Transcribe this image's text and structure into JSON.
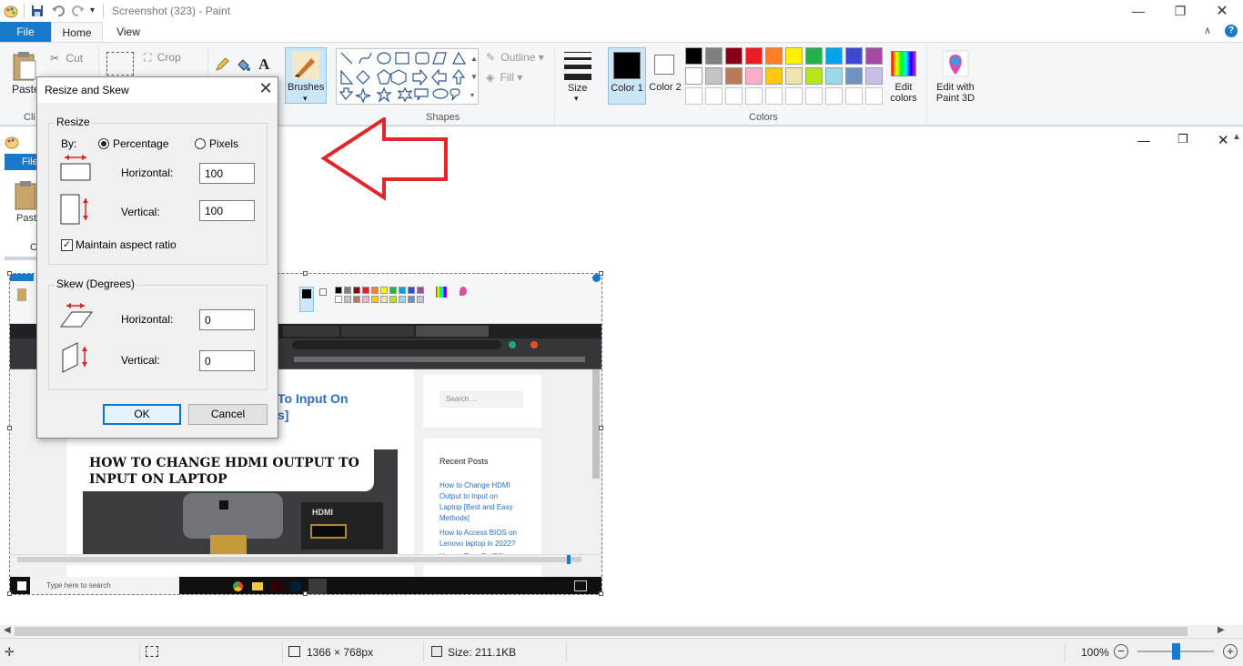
{
  "window": {
    "title": "Screenshot (323) - Paint"
  },
  "tabs": {
    "file": "File",
    "home": "Home",
    "view": "View"
  },
  "ribbon": {
    "clipboard": {
      "paste": "Paste",
      "cut": "Cut",
      "group": "Cli"
    },
    "image": {
      "crop": "Crop"
    },
    "brushes": "Brushes",
    "shapes": {
      "group": "Shapes",
      "outline": "Outline",
      "fill": "Fill"
    },
    "size": "Size",
    "color1": "Color 1",
    "color2": "Color 2",
    "colors_group": "Colors",
    "edit_colors": "Edit colors",
    "edit_paint3d": "Edit with Paint 3D",
    "palette_row1": [
      "#000000",
      "#7f7f7f",
      "#880015",
      "#ed1c24",
      "#ff7f27",
      "#fff200",
      "#22b14c",
      "#00a2e8",
      "#3f48cc",
      "#a349a4"
    ],
    "palette_row2": [
      "#ffffff",
      "#c3c3c3",
      "#b97a57",
      "#ffaec9",
      "#ffc90e",
      "#efe4b0",
      "#b5e61d",
      "#99d9ea",
      "#7092be",
      "#c8bfe7"
    ]
  },
  "dialog": {
    "title": "Resize and Skew",
    "resize": {
      "legend": "Resize",
      "by": "By:",
      "percentage": "Percentage",
      "pixels": "Pixels",
      "horizontal_label": "Horizontal:",
      "horizontal_value": "100",
      "vertical_label": "Vertical:",
      "vertical_value": "100",
      "aspect": "Maintain aspect ratio"
    },
    "skew": {
      "legend": "Skew (Degrees)",
      "horizontal_label": "Horizontal:",
      "horizontal_value": "0",
      "vertical_label": "Vertical:",
      "vertical_value": "0"
    },
    "ok": "OK",
    "cancel": "Cancel"
  },
  "embedded": {
    "heading_fragment_1": "To Input On",
    "heading_fragment_2": "s]",
    "banner_text": "HOW TO CHANGE HDMI OUTPUT TO INPUT ON LAPTOP",
    "port_label": "HDMI",
    "search_placeholder": "Search ...",
    "recent_posts": "Recent Posts",
    "posts": [
      "How to Change HDMI Output to Input on Laptop [Best and Easy Methods]",
      "How to Access BIOS on Lenovo laptop in 2022?",
      "How to Turn On/Off"
    ],
    "taskbar_search": "Type here to search",
    "file_label": "File"
  },
  "status": {
    "dimensions": "1366 × 768px",
    "size": "Size: 211.1KB",
    "zoom": "100%",
    "zoom_fraction": 0.5
  }
}
